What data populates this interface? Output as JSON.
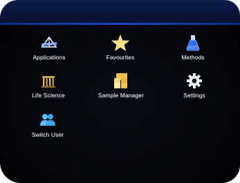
{
  "menu": {
    "items": [
      {
        "label": "Applications",
        "icon": "applications-icon"
      },
      {
        "label": "Favourites",
        "icon": "star-icon"
      },
      {
        "label": "Methods",
        "icon": "flask-icon"
      },
      {
        "label": "Life Science",
        "icon": "life-science-icon"
      },
      {
        "label": "Sample Manager",
        "icon": "sample-manager-icon"
      },
      {
        "label": "Settings",
        "icon": "gear-icon"
      },
      {
        "label": "Switch User",
        "icon": "users-icon"
      }
    ]
  },
  "colors": {
    "background": "#04060c",
    "top_bar": "#0d173f",
    "accent_line": "#1b49c2",
    "label_text": "#e9eef8",
    "star": "#ffe27a",
    "flask": "#2f6bff",
    "users": "#3aa7f0",
    "life_science": "#c8a24a",
    "sample_manager": "#f2c04b"
  }
}
